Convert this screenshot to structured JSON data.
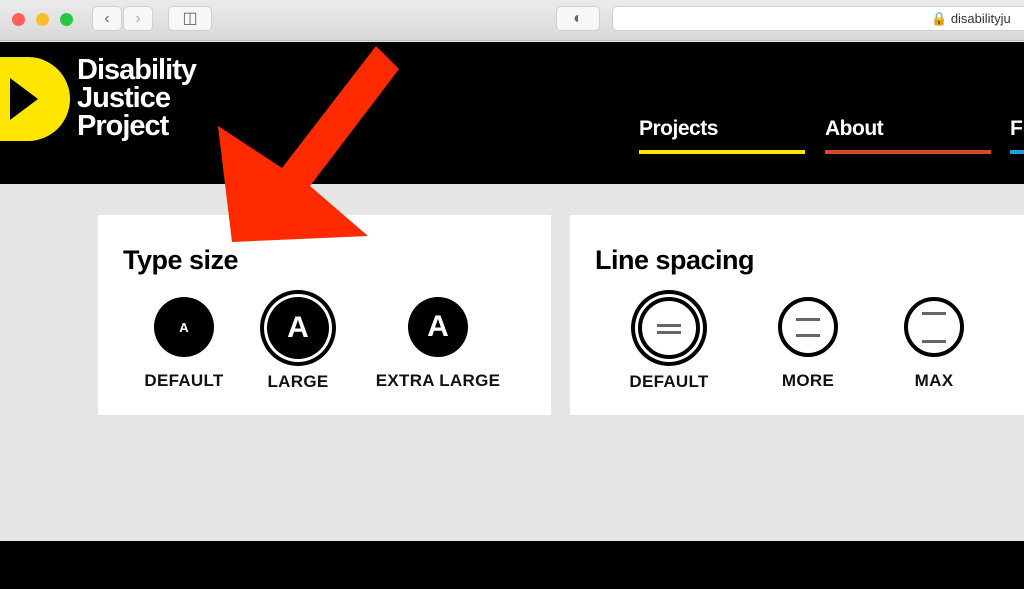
{
  "browser": {
    "url": "disabilityju",
    "back_icon": "chevron-left-icon",
    "forward_icon": "chevron-right-icon",
    "sidebar_icon": "sidebar-icon",
    "shield_icon": "shield-icon",
    "lock_icon": "lock-icon"
  },
  "header": {
    "logo": [
      "Disability",
      "Justice",
      "Project"
    ],
    "nav": [
      {
        "label": "Projects",
        "color": "#ffe600"
      },
      {
        "label": "About",
        "color": "#d9462a"
      },
      {
        "label": "F",
        "color": "#1aa0d8"
      }
    ]
  },
  "type_size": {
    "title": "Type size",
    "selected": "LARGE",
    "options": [
      {
        "glyph": "A",
        "label": "DEFAULT"
      },
      {
        "glyph": "A",
        "label": "LARGE"
      },
      {
        "glyph": "A",
        "label": "EXTRA LARGE"
      }
    ]
  },
  "line_spacing": {
    "title": "Line spacing",
    "selected": "DEFAULT",
    "options": [
      {
        "label": "DEFAULT"
      },
      {
        "label": "MORE"
      },
      {
        "label": "MAX"
      }
    ]
  },
  "annotation": {
    "arrow_color": "#ff2a00"
  }
}
